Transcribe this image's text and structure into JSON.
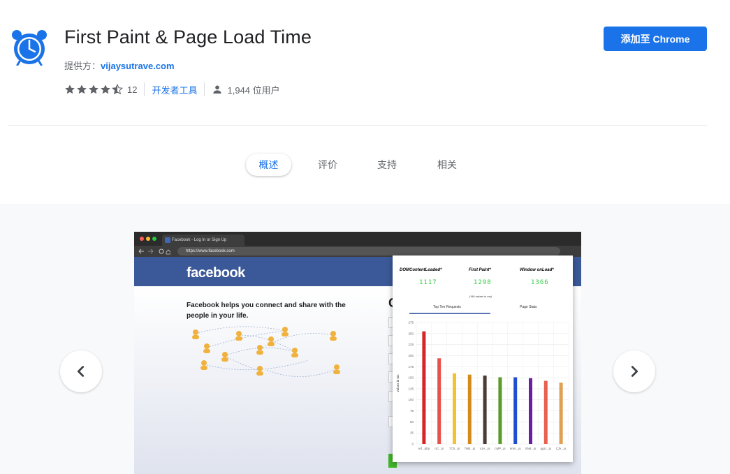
{
  "extension": {
    "title": "First Paint & Page Load Time",
    "provider_label": "提供方：",
    "provider_link": "vijaysutrave.com",
    "rating_count": "12",
    "category": "开发者工具",
    "users": "1,944 位用户",
    "add_button": "添加至 Chrome"
  },
  "tabs": [
    {
      "label": "概述",
      "active": true
    },
    {
      "label": "评价",
      "active": false
    },
    {
      "label": "支持",
      "active": false
    },
    {
      "label": "相关",
      "active": false
    }
  ],
  "screenshot": {
    "browser_tab": "Facebook - Log In or Sign Up",
    "url": "https://www.facebook.com",
    "fb_logo": "facebook",
    "fb_tagline": "Facebook helps you connect and share with the people in your life.",
    "popup": {
      "metrics": [
        {
          "label": "DOMContentLoaded*",
          "value": "1117"
        },
        {
          "label": "First Paint*",
          "value": "1298"
        },
        {
          "label": "Window onLoad*",
          "value": "1366"
        }
      ],
      "note": "(*All values in ms)",
      "tabs": [
        "Top Ten Requests",
        "Page Stats"
      ],
      "chart_data": {
        "type": "bar",
        "ylabel": "values in ms",
        "ylim": [
          0,
          275
        ],
        "yticks": [
          0,
          25,
          50,
          75,
          100,
          125,
          150,
          175,
          200,
          225,
          250,
          275
        ],
        "categories": [
          "ref...php",
          "nC...js",
          "7Cb...js",
          "7HB...js",
          "x1A...js",
          "cMP...js",
          "6nm...js",
          "SN8...js",
          "qgU...js",
          "Czk...js"
        ],
        "values": [
          255,
          194,
          160,
          157,
          155,
          151,
          151,
          149,
          143,
          139
        ],
        "colors": [
          "#d62728",
          "#e8504a",
          "#f2c230",
          "#d48a1a",
          "#4a3b36",
          "#5b9a2b",
          "#1f4fd1",
          "#6a1fa0",
          "#e8604f",
          "#e0a050"
        ]
      }
    }
  },
  "colors": {
    "accent": "#1a73e8",
    "gallery_bg": "#f8f9fa",
    "fb_blue": "#3b5998"
  }
}
